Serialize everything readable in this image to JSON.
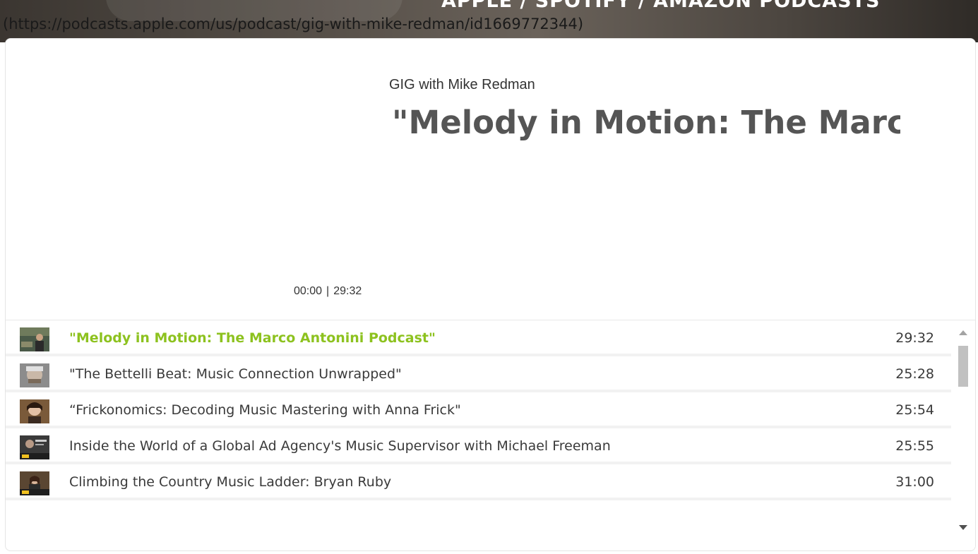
{
  "banner": {
    "heading": "APPLE / SPOTIFY / AMAZON PODCASTS",
    "link_text": "(https://podcasts.apple.com/us/podcast/gig-with-mike-redman/id1669772344)"
  },
  "player": {
    "show_name": "GIG with Mike Redman",
    "episode_title": "\"Melody in Motion: The Marco Antonini Podcast\"",
    "current_time": "00:00",
    "separator": "|",
    "total_time": "29:32"
  },
  "playlist": {
    "tracks": [
      {
        "title": "\"Melody in Motion: The Marco Antonini Podcast\"",
        "duration": "29:32",
        "active": true
      },
      {
        "title": "\"The Bettelli Beat: Music Connection Unwrapped\"",
        "duration": "25:28",
        "active": false
      },
      {
        "title": "“Frickonomics: Decoding Music Mastering with Anna Frick\"",
        "duration": "25:54",
        "active": false
      },
      {
        "title": "Inside the World of a Global Ad Agency's Music Supervisor with Michael Freeman",
        "duration": "25:55",
        "active": false
      },
      {
        "title": "Climbing the Country Music Ladder: Bryan Ruby",
        "duration": "31:00",
        "active": false
      }
    ]
  },
  "colors": {
    "active_track": "#8dc21f",
    "text": "#3a3a3a",
    "title": "#555555"
  },
  "icons": {
    "scroll_up": "triangle-up-icon",
    "scroll_down": "triangle-down-icon"
  }
}
